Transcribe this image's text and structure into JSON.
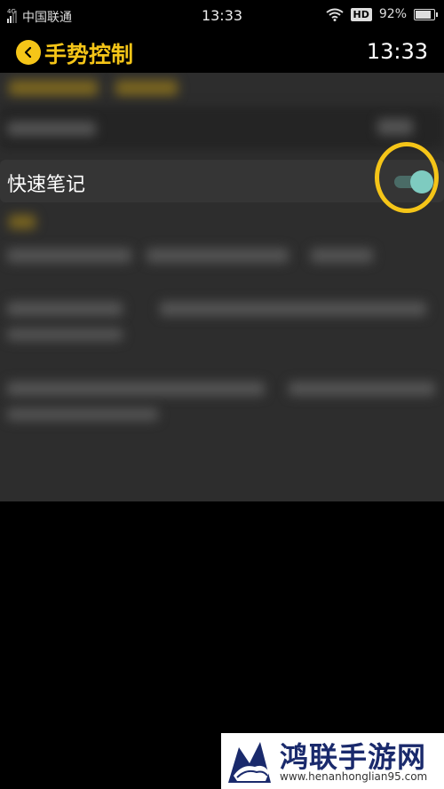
{
  "status_bar": {
    "network_tag": "4G",
    "carrier": "中国联通",
    "time": "13:33",
    "hd_badge": "HD",
    "battery": "92%",
    "battery_level": 0.92
  },
  "header": {
    "title": "手势控制",
    "time": "13:33",
    "accent_color": "#f5c518"
  },
  "settings": {
    "highlighted_row": {
      "label": "快速笔记",
      "toggle_on": true
    }
  },
  "watermark": {
    "title": "鸿联手游网",
    "url": "www.henanhonglian95.com"
  },
  "icons": [
    "back-chevron-icon",
    "signal-icon",
    "wifi-icon",
    "battery-icon"
  ]
}
